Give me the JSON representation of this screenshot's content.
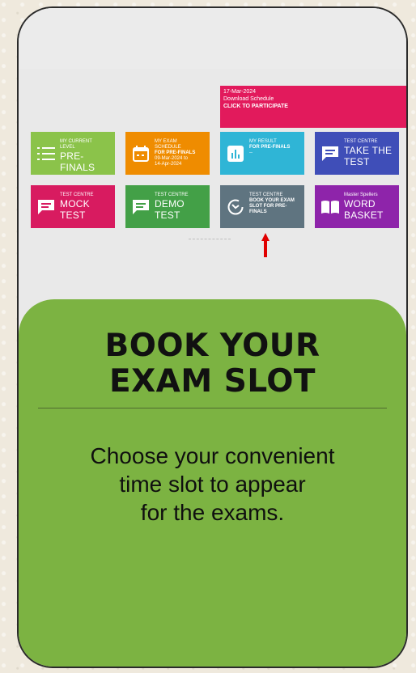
{
  "banner": {
    "date": "17-Mar-2024",
    "line2": "Download Schedule",
    "cta": "CLICK TO PARTICIPATE"
  },
  "tiles": [
    {
      "l1": "MY CURRENT",
      "l2": "LEVEL",
      "l3": "PRE-",
      "l4": "FINALS",
      "color": "#8bc34a",
      "icon": "list-icon"
    },
    {
      "l1": "MY EXAM",
      "l2": "SCHEDULE",
      "l3": "FOR PRE-FINALS",
      "l4": "09-Mar-2024 to",
      "l5": "14-Apr-2024",
      "color": "#ef8c00",
      "icon": "calendar-icon"
    },
    {
      "l1": "MY RESULT",
      "l2": "FOR PRE-FINALS",
      "l3": "--",
      "color": "#2fb5d6",
      "icon": "bar-chart-icon"
    },
    {
      "l1": "TEST CENTRE",
      "l2": "TAKE THE",
      "l3": "TEST",
      "color": "#3f4eb8",
      "icon": "chat-icon"
    },
    {
      "l1": "TEST CENTRE",
      "l2": "MOCK",
      "l3": "TEST",
      "color": "#d81b60",
      "icon": "chat-icon"
    },
    {
      "l1": "TEST CENTRE",
      "l2": "DEMO",
      "l3": "TEST",
      "color": "#43a047",
      "icon": "chat-icon"
    },
    {
      "l1": "TEST CENTRE",
      "l2": "BOOK YOUR EXAM",
      "l3": "SLOT FOR PRE-",
      "l4": "FINALS",
      "color": "#5f7480",
      "icon": "timer-icon"
    },
    {
      "l1": "Master Spellers",
      "l2": "WORD",
      "l3": "BASKET",
      "color": "#8e24aa",
      "icon": "book-icon"
    }
  ],
  "card": {
    "title_line1": "BOOK YOUR",
    "title_line2": "EXAM SLOT",
    "desc_line1": "Choose your convenient",
    "desc_line2": "time slot to appear",
    "desc_line3": "for the exams."
  },
  "colors": {
    "card": "#7cb342",
    "arrow": "#e00000",
    "banner": "#e21a5c"
  }
}
